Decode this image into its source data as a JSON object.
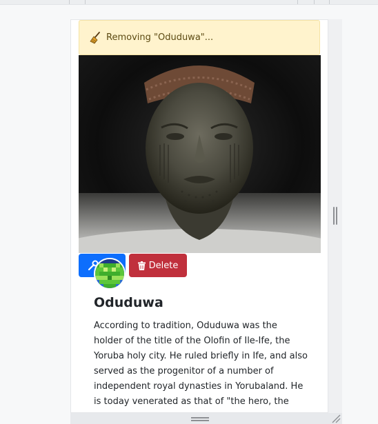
{
  "toast": {
    "message": "Removing \"Oduduwa\"...",
    "icon": "broom-icon",
    "background": "#fff3cd"
  },
  "card": {
    "title": "Oduduwa",
    "description": "According to tradition, Oduduwa was the holder of the title of the Olofin of Ile-Ife, the Yoruba holy city. He ruled briefly in Ife, and also served as the progenitor of a number of independent royal dynasties in Yorubaland. He is today venerated as that of \"the hero, the warrior, the leader and father of the Yoruba\"",
    "image": "bronze-head-photo",
    "edit_icon": "wrench-icon",
    "delete_label": "Delete",
    "delete_icon": "trash-icon"
  },
  "colors": {
    "primary": "#0d6efd",
    "danger": "#c0303c"
  }
}
